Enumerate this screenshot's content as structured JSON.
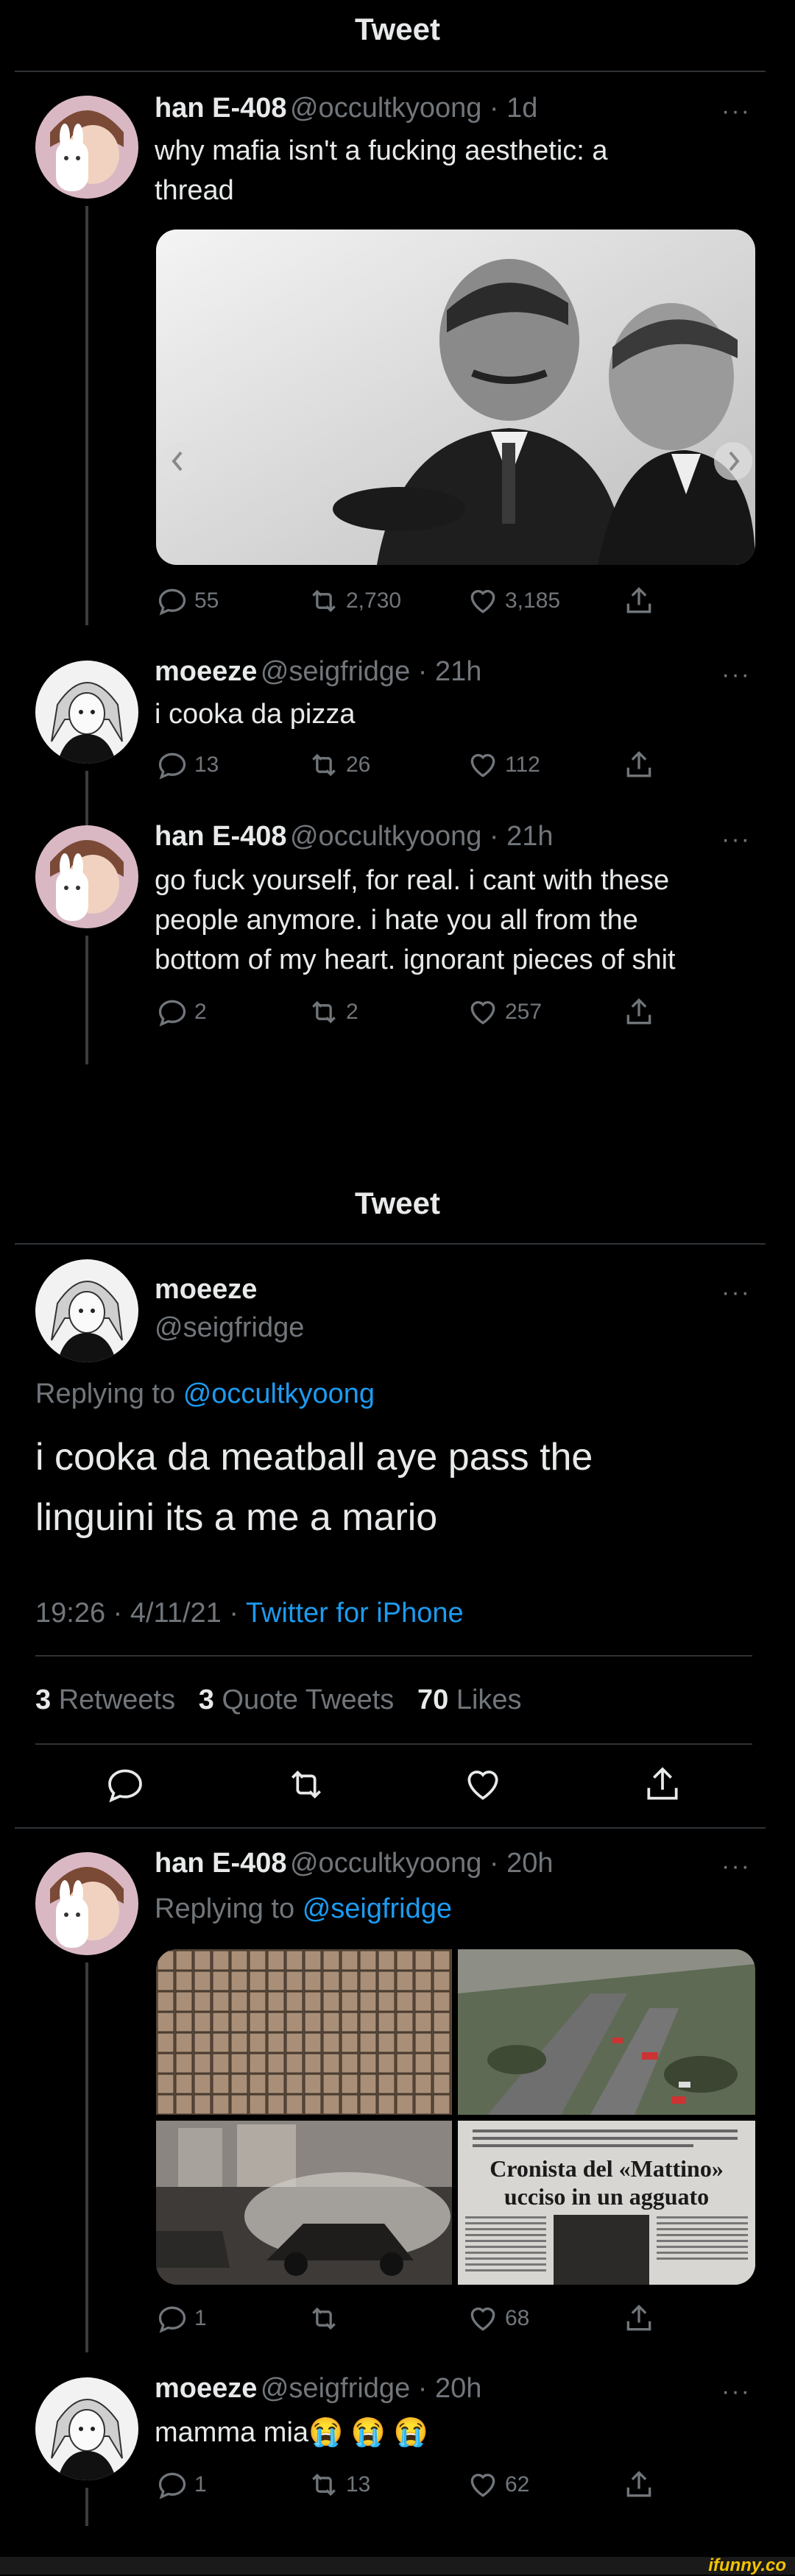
{
  "header_label": "Tweet",
  "thread1": {
    "tweet1": {
      "name": "han E-408",
      "handle_time": "@occultkyoong · 1d",
      "text_lines": [
        "why mafia isn't a fucking aesthetic: a",
        "thread"
      ],
      "replies": "55",
      "retweets": "2,730",
      "likes": "3,185"
    },
    "tweet2": {
      "name": "moeeze",
      "handle_time": "@seigfridge · 21h",
      "text": "i cooka da pizza",
      "replies": "13",
      "retweets": "26",
      "likes": "112"
    },
    "tweet3": {
      "name": "han E-408",
      "handle_time": "@occultkyoong · 21h",
      "text_lines": [
        "go fuck yourself, for real. i cant with these",
        "people anymore. i hate you all from the",
        "bottom of my heart. ignorant pieces of shit"
      ],
      "replies": "2",
      "retweets": "2",
      "likes": "257"
    }
  },
  "main_tweet": {
    "header_label": "Tweet",
    "name": "moeeze",
    "handle": "@seigfridge",
    "replying_prefix": "Replying to",
    "replying_to": "@occultkyoong",
    "text_lines": [
      "i cooka da meatball aye pass the",
      "linguini its a me a mario"
    ],
    "time": "19:26 · 4/11/21 · ",
    "source": "Twitter for iPhone",
    "stats": {
      "retweets_num": "3",
      "retweets_label": "Retweets",
      "quotes_num": "3",
      "quotes_label": "Quote Tweets",
      "likes_num": "70",
      "likes_label": "Likes"
    }
  },
  "reply1": {
    "name": "han E-408",
    "handle_time": "@occultkyoong · 20h",
    "replying_prefix": "Replying to",
    "replying_to": "@seigfridge",
    "newspaper_headline_1": "Cronista del «Mattino»",
    "newspaper_headline_2": "ucciso in un agguato",
    "replies": "1",
    "retweets": "",
    "likes": "68"
  },
  "reply2": {
    "name": "moeeze",
    "handle_time": "@seigfridge · 20h",
    "text": "mamma mia😭 😭 😭",
    "replies": "1",
    "retweets": "13",
    "likes": "62"
  },
  "watermark": "ifunny.co",
  "colors": {
    "bg": "#000000",
    "text": "#e7e9ea",
    "muted": "#71767b",
    "link": "#1d9bf0",
    "divider": "#2f3336"
  }
}
